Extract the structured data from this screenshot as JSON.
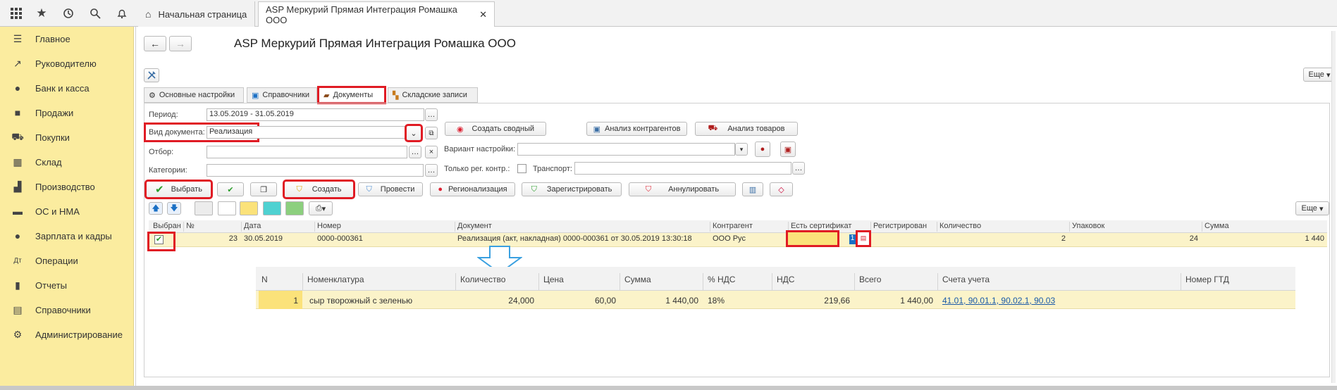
{
  "app": {
    "tabs": {
      "home": "Начальная страница",
      "active": "ASP Меркурий Прямая Интеграция Ромашка ООО"
    }
  },
  "sidebar": {
    "items": [
      {
        "label": "Главное",
        "icon": "menu-icon"
      },
      {
        "label": "Руководителю",
        "icon": "trend-icon"
      },
      {
        "label": "Банк и касса",
        "icon": "coin-icon"
      },
      {
        "label": "Продажи",
        "icon": "bag-icon"
      },
      {
        "label": "Покупки",
        "icon": "cart-icon"
      },
      {
        "label": "Склад",
        "icon": "warehouse-icon"
      },
      {
        "label": "Производство",
        "icon": "factory-icon"
      },
      {
        "label": "ОС и НМА",
        "icon": "truck-icon"
      },
      {
        "label": "Зарплата и кадры",
        "icon": "person-icon"
      },
      {
        "label": "Операции",
        "icon": "operations-icon"
      },
      {
        "label": "Отчеты",
        "icon": "chart-icon"
      },
      {
        "label": "Справочники",
        "icon": "book-icon"
      },
      {
        "label": "Администрирование",
        "icon": "gear-icon"
      }
    ]
  },
  "form": {
    "title": "ASP Меркурий Прямая Интеграция Ромашка ООО",
    "more": "Еще",
    "tabs": [
      "Основные настройки",
      "Справочники",
      "Документы",
      "Складские записи"
    ],
    "period_label": "Период:",
    "period_value": "13.05.2019 - 31.05.2019",
    "doc_type_label": "Вид документа:",
    "doc_type_value": "Реализация",
    "filter_label": "Отбор:",
    "category_label": "Категории:",
    "create_summary": "Создать сводный",
    "analyze_contractors": "Анализ контрагентов",
    "analyze_goods": "Анализ товаров",
    "variant_label": "Вариант настройки:",
    "only_reg_label": "Только рег. контр.:",
    "transport_label": "Транспорт:",
    "buttons": {
      "select": "Выбрать",
      "create": "Создать",
      "post": "Провести",
      "regionalize": "Регионализация",
      "register": "Зарегистрировать",
      "cancel": "Аннулировать"
    }
  },
  "grid": {
    "columns": [
      "Выбран",
      "№",
      "Дата",
      "Номер",
      "Документ",
      "Контрагент",
      "Есть сертификат",
      "Регистрирован",
      "Количество",
      "Упаковок",
      "Сумма"
    ],
    "row": {
      "num": "23",
      "date": "30.05.2019",
      "number": "0000-000361",
      "document": "Реализация (акт, накладная) 0000-000361 от 30.05.2019 13:30:18",
      "contractor": "ООО Рус",
      "qty": "2",
      "packs": "24",
      "sum": "1 440",
      "cert_mark": "1"
    }
  },
  "subtable": {
    "columns": [
      "N",
      "Номенклатура",
      "Количество",
      "Цена",
      "Сумма",
      "% НДС",
      "НДС",
      "Всего",
      "Счета учета",
      "Номер ГТД"
    ],
    "row": {
      "n": "1",
      "item": "сыр творожный с зеленью",
      "qty": "24,000",
      "price": "60,00",
      "sum": "1 440,00",
      "vat_rate": "18%",
      "vat": "219,66",
      "total": "1 440,00",
      "accounts": "41.01, 90.01.1, 90.02.1, 90.03"
    }
  },
  "colors": {
    "sidebar": "#fbec9f",
    "highlight": "#e01b24",
    "row": "#fbf3c9",
    "link": "#1a5aa8"
  }
}
